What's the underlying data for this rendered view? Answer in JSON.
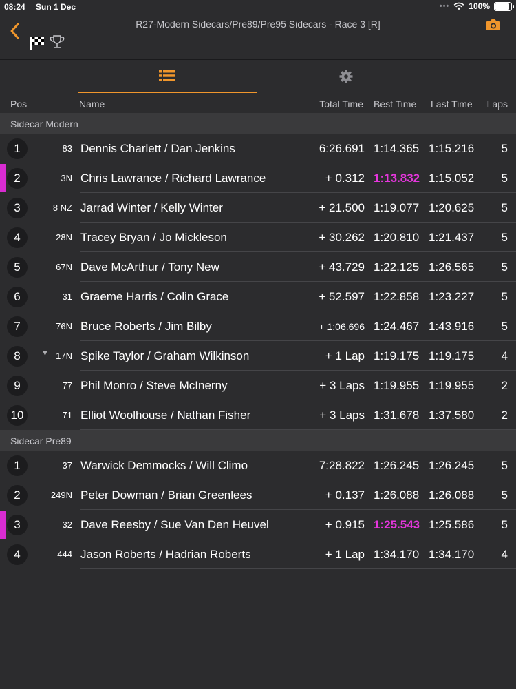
{
  "status": {
    "time": "08:24",
    "date": "Sun 1 Dec",
    "battery": "100%",
    "battery_level": 1.0
  },
  "header": {
    "title": "R27-Modern Sidecars/Pre89/Pre95 Sidecars - Race 3 [R]"
  },
  "icons": {
    "back": "chevron-left-icon",
    "flag": "checkered-flag-icon",
    "trophy": "trophy-icon",
    "camera": "camera-icon",
    "list": "list-icon",
    "settings": "gear-icon"
  },
  "colors": {
    "accent": "#f0962c",
    "highlight": "#e536dc",
    "background": "#2c2c2e",
    "section": "#3a3a3c"
  },
  "columns": {
    "pos": "Pos",
    "name": "Name",
    "total": "Total Time",
    "best": "Best Time",
    "last": "Last Time",
    "laps": "Laps"
  },
  "sections": [
    {
      "title": "Sidecar Modern",
      "rows": [
        {
          "pos": "1",
          "num": "83",
          "name": "Dennis Charlett / Dan Jenkins",
          "total": "6:26.691",
          "best": "1:14.365",
          "last": "1:15.216",
          "laps": "5"
        },
        {
          "pos": "2",
          "num": "3N",
          "name": "Chris Lawrance / Richard Lawrance",
          "total": "+ 0.312",
          "best": "1:13.832",
          "last": "1:15.052",
          "laps": "5",
          "fastest": true
        },
        {
          "pos": "3",
          "num": "8 NZ",
          "name": "Jarrad Winter / Kelly Winter",
          "total": "+ 21.500",
          "best": "1:19.077",
          "last": "1:20.625",
          "laps": "5"
        },
        {
          "pos": "4",
          "num": "28N",
          "name": "Tracey Bryan / Jo Mickleson",
          "total": "+ 30.262",
          "best": "1:20.810",
          "last": "1:21.437",
          "laps": "5"
        },
        {
          "pos": "5",
          "num": "67N",
          "name": "Dave McArthur / Tony New",
          "total": "+ 43.729",
          "best": "1:22.125",
          "last": "1:26.565",
          "laps": "5"
        },
        {
          "pos": "6",
          "num": "31",
          "name": "Graeme Harris / Colin Grace",
          "total": "+ 52.597",
          "best": "1:22.858",
          "last": "1:23.227",
          "laps": "5"
        },
        {
          "pos": "7",
          "num": "76N",
          "name": "Bruce Roberts / Jim Bilby",
          "total": "+ 1:06.696",
          "best": "1:24.467",
          "last": "1:43.916",
          "laps": "5",
          "small_total": true
        },
        {
          "pos": "8",
          "num": "17N",
          "name": "Spike Taylor / Graham Wilkinson",
          "total": "+ 1 Lap",
          "best": "1:19.175",
          "last": "1:19.175",
          "laps": "4",
          "arrow": "▼"
        },
        {
          "pos": "9",
          "num": "77",
          "name": "Phil Monro / Steve McInerny",
          "total": "+ 3 Laps",
          "best": "1:19.955",
          "last": "1:19.955",
          "laps": "2"
        },
        {
          "pos": "10",
          "num": "71",
          "name": "Elliot Woolhouse / Nathan Fisher",
          "total": "+ 3 Laps",
          "best": "1:31.678",
          "last": "1:37.580",
          "laps": "2"
        }
      ]
    },
    {
      "title": "Sidecar Pre89",
      "rows": [
        {
          "pos": "1",
          "num": "37",
          "name": "Warwick Demmocks / Will Climo",
          "total": "7:28.822",
          "best": "1:26.245",
          "last": "1:26.245",
          "laps": "5"
        },
        {
          "pos": "2",
          "num": "249N",
          "name": "Peter Dowman / Brian Greenlees",
          "total": "+ 0.137",
          "best": "1:26.088",
          "last": "1:26.088",
          "laps": "5"
        },
        {
          "pos": "3",
          "num": "32",
          "name": "Dave Reesby / Sue Van Den Heuvel",
          "total": "+ 0.915",
          "best": "1:25.543",
          "last": "1:25.586",
          "laps": "5",
          "fastest": true
        },
        {
          "pos": "4",
          "num": "444",
          "name": "Jason Roberts / Hadrian Roberts",
          "total": "+ 1 Lap",
          "best": "1:34.170",
          "last": "1:34.170",
          "laps": "4"
        }
      ]
    }
  ]
}
